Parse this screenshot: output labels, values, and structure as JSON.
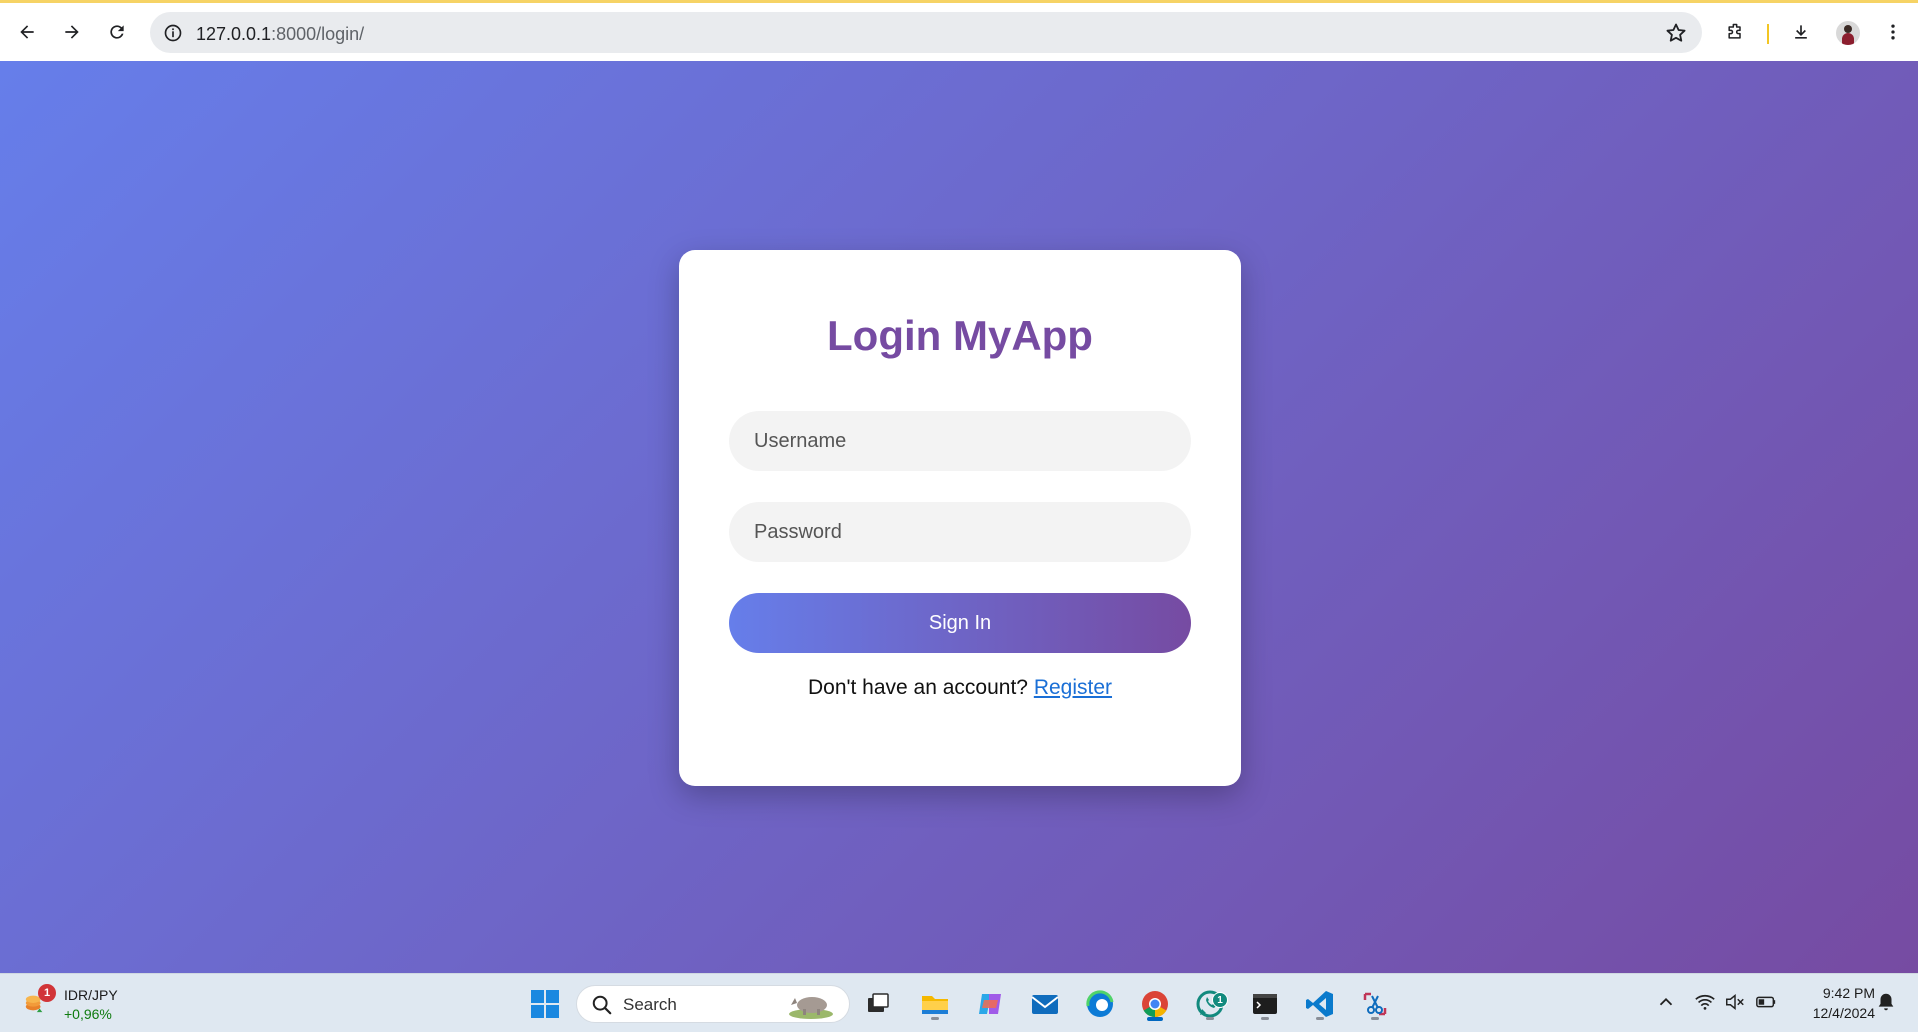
{
  "browser": {
    "url_host": "127.0.0.1",
    "url_path": ":8000/login/",
    "accent_color": "#f6d365"
  },
  "login": {
    "title": "Login MyApp",
    "username_placeholder": "Username",
    "password_placeholder": "Password",
    "signin_label": "Sign In",
    "register_prompt": "Don't have an account? ",
    "register_link": "Register",
    "gradient_start": "#667eea",
    "gradient_end": "#764ba2"
  },
  "taskbar": {
    "widget": {
      "badge": "1",
      "pair": "IDR/JPY",
      "change": "+0,96%"
    },
    "search_label": "Search",
    "whatsapp_badge": "1",
    "icons": [
      "start-icon",
      "search-icon",
      "task-view-icon",
      "file-explorer-icon",
      "copilot-icon",
      "mail-icon",
      "edge-icon",
      "chrome-icon",
      "whatsapp-icon",
      "terminal-icon",
      "vscode-icon",
      "snipping-tool-icon"
    ],
    "tray": [
      "chevron-up-icon",
      "wifi-icon",
      "volume-muted-icon",
      "battery-icon",
      "notification-bell-icon"
    ],
    "time": "9:42 PM",
    "date": "12/4/2024"
  }
}
